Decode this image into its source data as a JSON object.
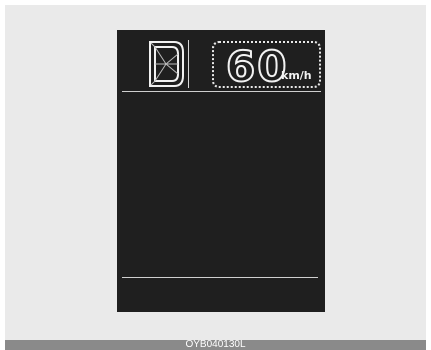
{
  "display": {
    "gear": "D",
    "speed_value": "60",
    "speed_unit": "km/h"
  },
  "caption": {
    "code": "OYB040130L"
  },
  "colors": {
    "screen": "#1f1f1f",
    "segment": "#f2f2f2",
    "background": "#eaeaea",
    "caption_bar": "#8a8a8a"
  }
}
